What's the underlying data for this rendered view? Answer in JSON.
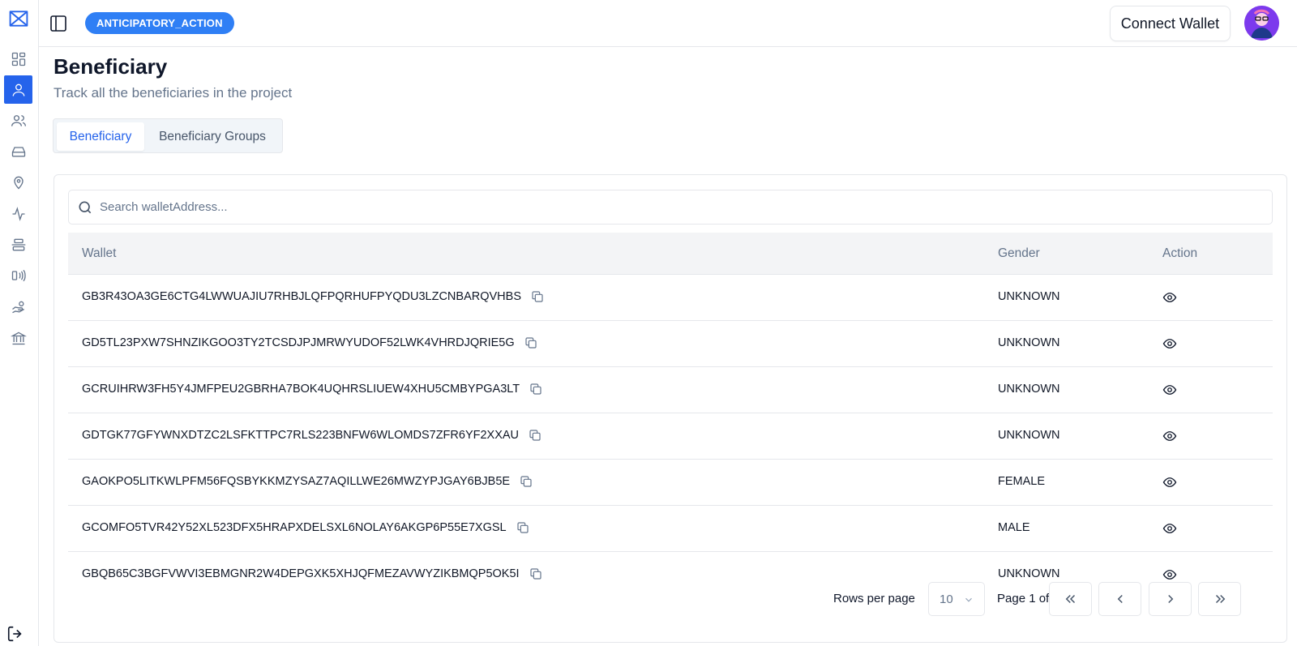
{
  "header": {
    "project_badge": "ANTICIPATORY_ACTION",
    "connect_wallet_label": "Connect Wallet"
  },
  "sidebar": {
    "items": [
      {
        "icon": "dashboard-icon"
      },
      {
        "icon": "beneficiary-icon",
        "active": true
      },
      {
        "icon": "groups-icon"
      },
      {
        "icon": "inbox-icon"
      },
      {
        "icon": "location-pin-icon"
      },
      {
        "icon": "activity-icon"
      },
      {
        "icon": "align-center-icon"
      },
      {
        "icon": "broadcast-icon"
      },
      {
        "icon": "hand-coins-icon"
      },
      {
        "icon": "bank-icon"
      }
    ],
    "logout_icon": "logout-icon"
  },
  "page": {
    "title": "Beneficiary",
    "subtitle": "Track all the beneficiaries in the project"
  },
  "tabs": [
    {
      "label": "Beneficiary",
      "active": true
    },
    {
      "label": "Beneficiary Groups",
      "active": false
    }
  ],
  "search": {
    "placeholder": "Search walletAddress...",
    "value": ""
  },
  "table": {
    "columns": [
      "Wallet",
      "Gender",
      "Action"
    ],
    "rows": [
      {
        "wallet": "GB3R43OA3GE6CTG4LWWUAJIU7RHBJLQFPQRHUFPYQDU3LZCNBARQVHBS",
        "gender": "UNKNOWN"
      },
      {
        "wallet": "GD5TL23PXW7SHNZIKGOO3TY2TCSDJPJMRWYUDOF52LWK4VHRDJQRIE5G",
        "gender": "UNKNOWN"
      },
      {
        "wallet": "GCRUIHRW3FH5Y4JMFPEU2GBRHA7BOK4UQHRSLIUEW4XHU5CMBYPGA3LT",
        "gender": "UNKNOWN"
      },
      {
        "wallet": "GDTGK77GFYWNXDTZC2LSFKTTPC7RLS223BNFW6WLOMDS7ZFR6YF2XXAU",
        "gender": "UNKNOWN"
      },
      {
        "wallet": "GAOKPO5LITKWLPFM56FQSBYKKMZYSAZ7AQILLWE26MWZYPJGAY6BJB5E",
        "gender": "FEMALE"
      },
      {
        "wallet": "GCOMFO5TVR42Y52XL523DFX5HRAPXDELSXL6NOLAY6AKGP6P55E7XGSL",
        "gender": "MALE"
      },
      {
        "wallet": "GBQB65C3BGFVWVI3EBMGNR2W4DEPGXK5XHJQFMEZAVWYZIKBMQP5OK5I",
        "gender": "UNKNOWN"
      }
    ]
  },
  "pagination": {
    "rows_per_page_label": "Rows per page",
    "rows_per_page_value": "10",
    "page_info": "Page 1 of 1"
  },
  "colors": {
    "accent": "#2563eb",
    "badge": "#2f7ff5"
  }
}
